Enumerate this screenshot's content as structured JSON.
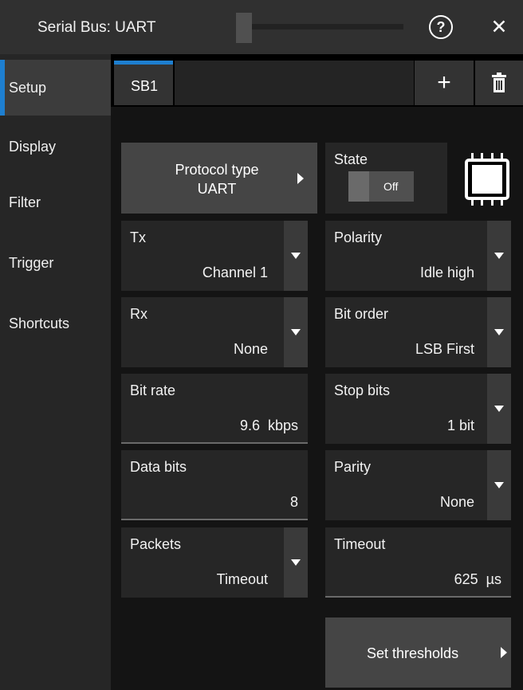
{
  "window": {
    "title": "Serial Bus: UART",
    "help_glyph": "?",
    "close_glyph": "✕"
  },
  "sidebar": {
    "items": [
      {
        "label": "Setup",
        "active": true
      },
      {
        "label": "Display",
        "active": false
      },
      {
        "label": "Filter",
        "active": false
      },
      {
        "label": "Trigger",
        "active": false
      },
      {
        "label": "Shortcuts",
        "active": false
      }
    ]
  },
  "tabs": {
    "active_label": "SB1",
    "add_glyph": "+"
  },
  "protocol": {
    "label": "Protocol type",
    "value": "UART"
  },
  "state": {
    "label": "State",
    "value": "Off"
  },
  "fields": {
    "tx": {
      "label": "Tx",
      "value": "Channel 1"
    },
    "polarity": {
      "label": "Polarity",
      "value": "Idle high"
    },
    "rx": {
      "label": "Rx",
      "value": "None"
    },
    "bit_order": {
      "label": "Bit order",
      "value": "LSB First"
    },
    "bit_rate": {
      "label": "Bit rate",
      "value": "9.6  kbps"
    },
    "stop_bits": {
      "label": "Stop bits",
      "value": "1 bit"
    },
    "data_bits": {
      "label": "Data bits",
      "value": "8"
    },
    "parity": {
      "label": "Parity",
      "value": "None"
    },
    "packets": {
      "label": "Packets",
      "value": "Timeout"
    },
    "timeout": {
      "label": "Timeout",
      "value": "625  µs"
    }
  },
  "set_thresholds": {
    "label": "Set thresholds"
  },
  "colors": {
    "accent": "#1e7fd0",
    "panel": "#262626",
    "button": "#454545"
  },
  "icons": [
    "help-icon",
    "close-icon",
    "plus-icon",
    "trash-icon",
    "chip-icon",
    "dropdown-arrow-icon",
    "arrow-right-icon"
  ]
}
